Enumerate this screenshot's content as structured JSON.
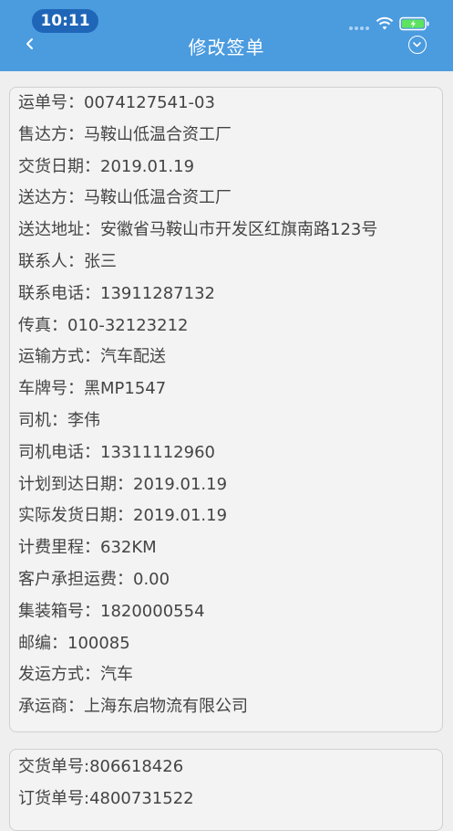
{
  "status_bar": {
    "time": "10:11"
  },
  "header": {
    "title": "修改签单"
  },
  "card1": {
    "rows": [
      {
        "label": "运单号",
        "value": "0074127541-03"
      },
      {
        "label": "售达方",
        "value": "马鞍山低温合资工厂"
      },
      {
        "label": "交货日期",
        "value": "2019.01.19"
      },
      {
        "label": "送达方",
        "value": "马鞍山低温合资工厂"
      },
      {
        "label": "送达地址",
        "value": "安徽省马鞍山市开发区红旗南路123号"
      },
      {
        "label": "联系人",
        "value": "张三"
      },
      {
        "label": "联系电话",
        "value": "13911287132"
      },
      {
        "label": "传真",
        "value": "010-32123212"
      },
      {
        "label": "运输方式",
        "value": "汽车配送"
      },
      {
        "label": "车牌号",
        "value": "黑MP1547"
      },
      {
        "label": "司机",
        "value": "李伟"
      },
      {
        "label": "司机电话",
        "value": "13311112960"
      },
      {
        "label": "计划到达日期",
        "value": "2019.01.19"
      },
      {
        "label": "实际发货日期",
        "value": "2019.01.19"
      },
      {
        "label": "计费里程",
        "value": "632KM"
      },
      {
        "label": "客户承担运费",
        "value": "0.00"
      },
      {
        "label": "集装箱号",
        "value": "1820000554"
      },
      {
        "label": "邮编",
        "value": "100085"
      },
      {
        "label": "发运方式",
        "value": "汽车"
      },
      {
        "label": "承运商",
        "value": "上海东启物流有限公司"
      }
    ],
    "separator": "："
  },
  "card2": {
    "rows": [
      {
        "label": "交货单号",
        "value": "806618426"
      },
      {
        "label": "订货单号",
        "value": "4800731522"
      }
    ],
    "separator": ":"
  }
}
